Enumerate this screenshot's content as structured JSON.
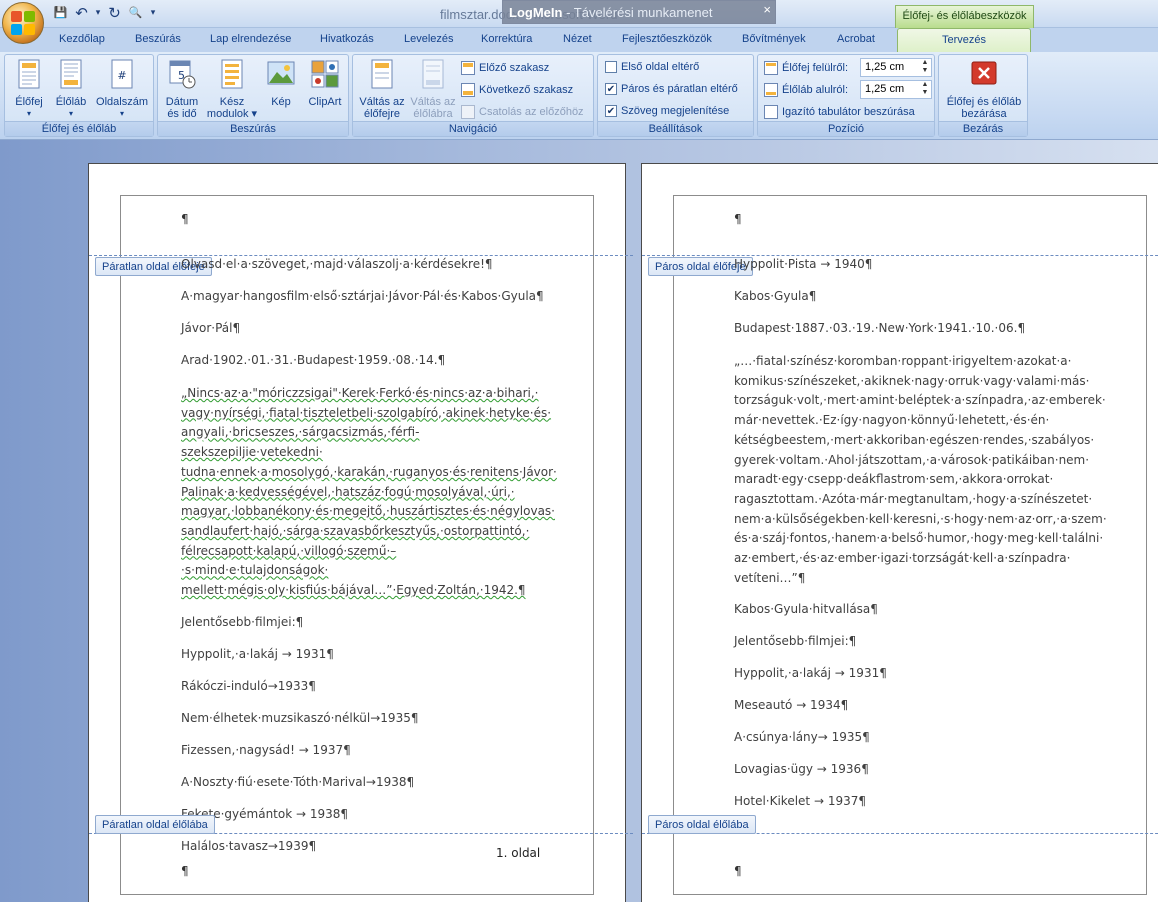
{
  "window": {
    "doc_title": "filmsztar.docx - Microsoft Word",
    "overlay_app": "LogMeIn",
    "overlay_text": "- Távelérési munkamenet",
    "overlay_close": "×",
    "context_header": "Élőfej- és élőlábeszközök"
  },
  "qat": {
    "save_glyph": "💾",
    "undo_glyph": "↶",
    "redo_glyph": "↻",
    "print_glyph": "🔍",
    "more_glyph": "▾"
  },
  "tabs": [
    "Kezdőlap",
    "Beszúrás",
    "Lap elrendezése",
    "Hivatkozás",
    "Levelezés",
    "Korrektúra",
    "Nézet",
    "Fejlesztőeszközök",
    "Bővítmények",
    "Acrobat",
    "Tervezés"
  ],
  "ribbon": {
    "group_headerfooter": {
      "label": "Élőfej és élőláb",
      "header": "Élőfej",
      "footer": "Élőláb",
      "pagenum": "Oldalszám"
    },
    "group_insert": {
      "label": "Beszúrás",
      "datetime_1": "Dátum",
      "datetime_2": "és idő",
      "quickparts_1": "Kész",
      "quickparts_2": "modulok",
      "picture": "Kép",
      "clipart": "ClipArt"
    },
    "group_nav": {
      "label": "Navigáció",
      "goto_header_1": "Váltás az",
      "goto_header_2": "élőfejre",
      "goto_footer_1": "Váltás az",
      "goto_footer_2": "élőlábra",
      "prev": "Előző szakasz",
      "next": "Következő szakasz",
      "link": "Csatolás az előzőhöz"
    },
    "group_options": {
      "label": "Beállítások",
      "first_page": "Első oldal eltérő",
      "odd_even": "Páros és páratlan eltérő",
      "show_text": "Szöveg megjelenítése",
      "first_page_checked": "",
      "odd_even_checked": "✔",
      "show_text_checked": "✔"
    },
    "group_position": {
      "label": "Pozíció",
      "header_top": "Élőfej felülről:",
      "footer_bottom": "Élőláb alulról:",
      "header_value": "1,25 cm",
      "footer_value": "1,25 cm",
      "align_tab": "Igazító tabulátor beszúrása"
    },
    "group_close": {
      "label": "Bezárás",
      "close_1": "Élőfej és élőláb",
      "close_2": "bezárása"
    }
  },
  "colors": {
    "accent": "#15428b",
    "context_green": "#8fb86a",
    "close_red": "#d33a2c"
  },
  "pages": {
    "odd": {
      "header_tag": "Páratlan oldal élőfeje",
      "footer_tag": "Páratlan oldal élőlába",
      "pilcrow": "¶",
      "footer_text": "1. oldal",
      "paragraphs": [
        "Olvasd·el·a·szöveget,·majd·válaszolj·a·kérdésekre!¶",
        "A·magyar·hangosfilm·első·sztárjai·Jávor·Pál·és·Kabos·Gyula¶",
        "Jávor·Pál¶",
        "Arad·1902.·01.·31.·Budapest·1959.·08.·14.¶"
      ],
      "quote": "„Nincs·az·a·\"móriczzsigai\"·Kerek·Ferkó·és·nincs·az·a·bihari,· vagy·nyírségi,·fiatal·tiszteletbeli·szolgabíró,·akinek·hetyke·és· angyali,·bricseszes,·sárgacsizmás,·férfi-szekszepiljie·vetekedni· tudna·ennek·a·mosolygó,·karakán,·ruganyos·és·renitens·Jávor· Palinak·a·kedvességével,·hatszáz·fogú·mosolyával,·úri,· magyar,·lobbanékony·és·megejtő,·huszártisztes·és·négylovas· sandlaufert·hajó,·sárga·szavasbőrkesztyűs,·ostorpattintó,· félrecsapott·kalapú,·villogó·szemű·–·s·mind·e·tulajdonságok· mellett·mégis·oly·kisfiús·bájával…”·Egyed·Zoltán,·1942.¶",
      "after": [
        "Jelentősebb·filmjei:¶",
        "Hyppolit,·a·lakáj → 1931¶",
        "Rákóczi-induló→1933¶",
        "Nem·élhetek·muzsikaszó·nélkül→1935¶",
        "Fizessen,·nagysád! → 1937¶",
        "A·Noszty·fiú·esete·Tóth·Marival→1938¶",
        "Fekete·gyémántok → 1938¶",
        "Halálos·tavasz→1939¶"
      ]
    },
    "even": {
      "header_tag": "Páros oldal élőfeje",
      "footer_tag": "Páros oldal élőlába",
      "pilcrow": "¶",
      "paragraphs": [
        "Hyppolit·Pista → 1940¶",
        "Kabos·Gyula¶",
        "Budapest·1887.·03.·19.·New·York·1941.·10.·06.¶"
      ],
      "quote": "„…·fiatal·színész·koromban·roppant·irigyeltem·azokat·a· komikus·színészeket,·akiknek·nagy·orruk·vagy·valami·más· torzságuk·volt,·mert·amint·beléptek·a·színpadra,·az·emberek· már·nevettek.·Ez·így·nagyon·könnyű·lehetett,·és·én· kétségbeestem,·mert·akkoriban·egészen·rendes,·szabályos· gyerek·voltam.·Ahol·játszottam,·a·városok·patikáiban·nem· maradt·egy·csepp·deákflastrom·sem,·akkora·orrokat· ragasztottam.·Azóta·már·megtanultam,·hogy·a·színészetet· nem·a·külsőségekben·kell·keresni,·s·hogy·nem·az·orr,·a·szem· és·a·száj·fontos,·hanem·a·belső·humor,·hogy·meg·kell·találni· az·embert,·és·az·ember·igazi·torzságát·kell·a·színpadra· vetíteni…”¶",
      "after": [
        "Kabos·Gyula·hitvallása¶",
        "Jelentősebb·filmjei:¶",
        "Hyppolit,·a·lakáj → 1931¶",
        "Meseautó → 1934¶",
        "A·csúnya·lány→ 1935¶",
        "Lovagias·ügy → 1936¶",
        "Hotel·Kikelet → 1937¶"
      ]
    }
  }
}
